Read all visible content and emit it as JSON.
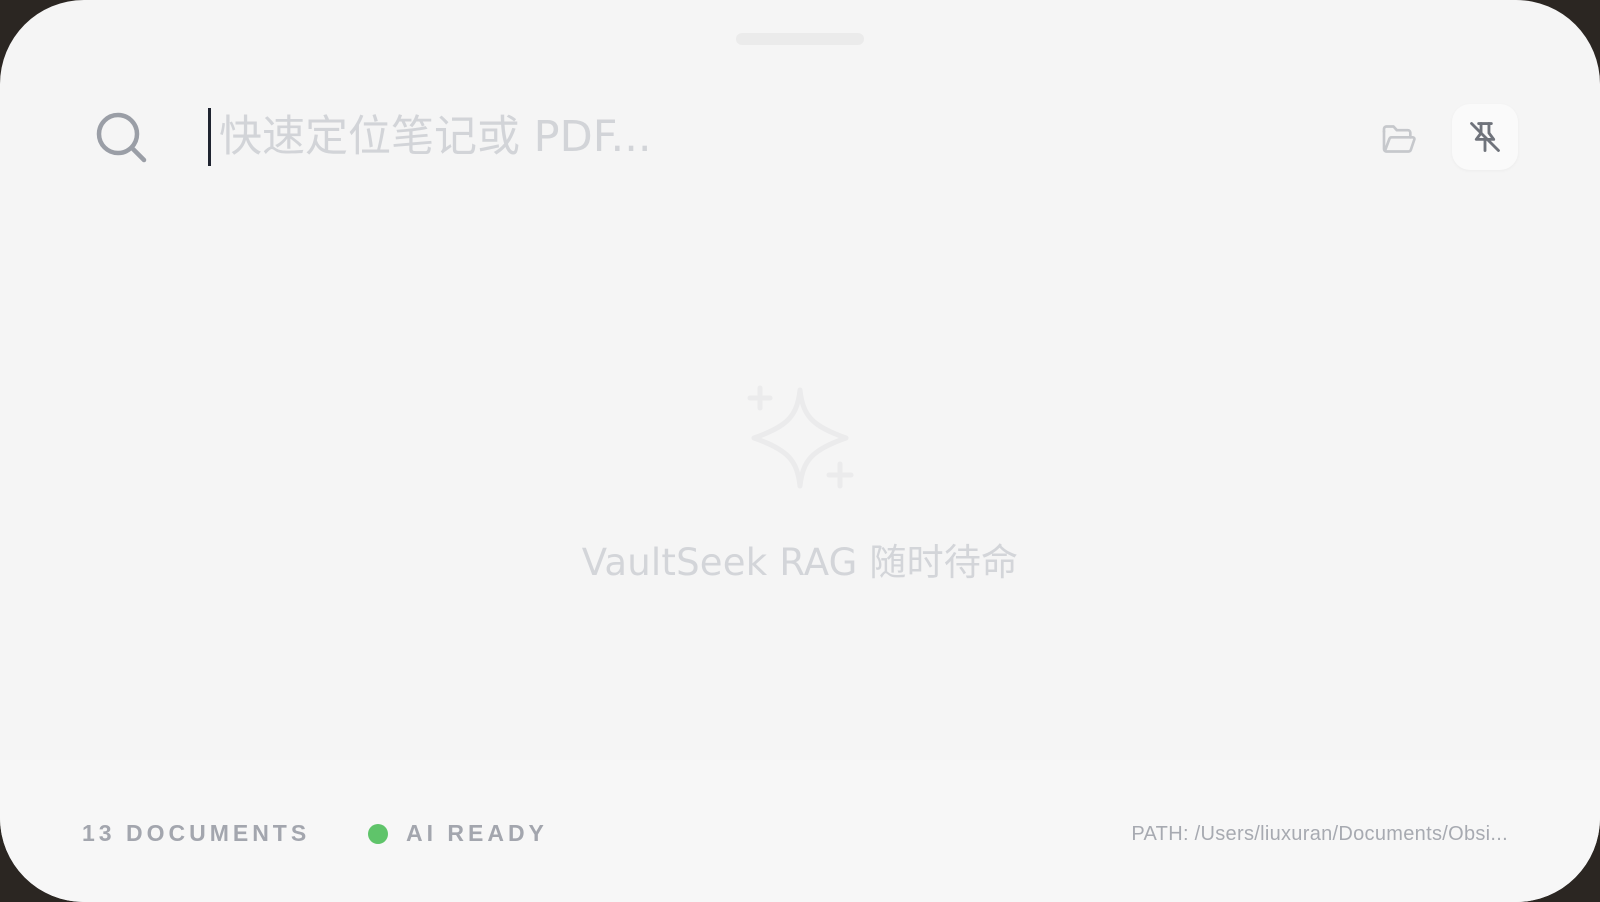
{
  "search": {
    "placeholder": "快速定位笔记或 PDF...",
    "value": ""
  },
  "toolbar": {
    "folder_icon": "folder-open-icon",
    "pin_icon": "pin-off-icon"
  },
  "empty_state": {
    "icon": "sparkles-icon",
    "message": "VaultSeek RAG 随时待命"
  },
  "footer": {
    "documents": "13 DOCUMENTS",
    "ai_status": "AI READY",
    "path": "PATH: /Users/liuxuran/Documents/Obsi..."
  },
  "colors": {
    "background": "#f5f5f5",
    "status_ready": "#5fc46a",
    "muted_text": "#a3a6ae",
    "placeholder": "#d2d4d8"
  }
}
